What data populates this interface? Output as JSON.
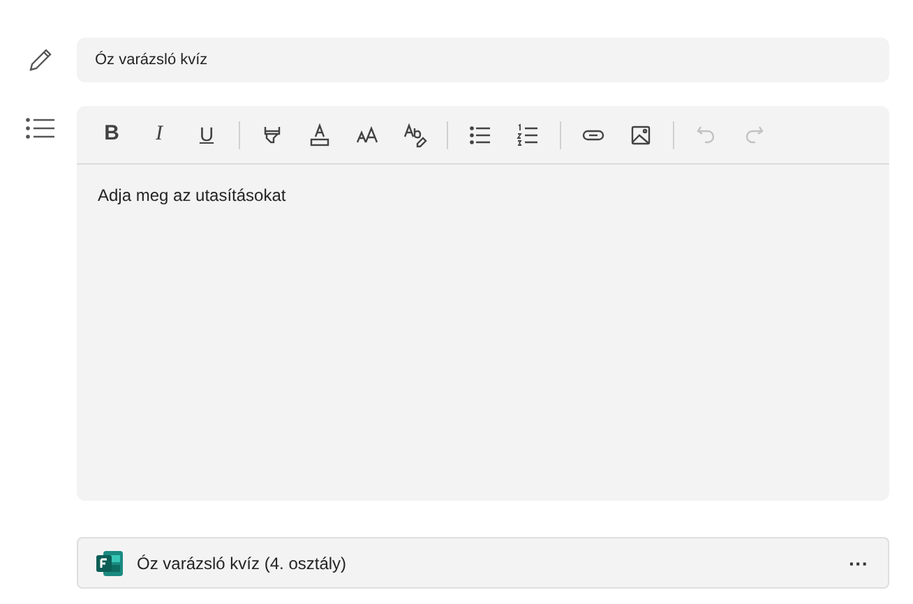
{
  "title_field": {
    "value": "Óz varázsló kvíz"
  },
  "toolbar": {
    "groups": [
      [
        {
          "kind": "bold",
          "glyph": "B",
          "disabled": false
        },
        {
          "kind": "italic",
          "glyph": "I",
          "disabled": false
        },
        {
          "kind": "underline",
          "glyph": "U",
          "disabled": false
        }
      ],
      [
        {
          "kind": "highlight",
          "disabled": false
        },
        {
          "kind": "font-color",
          "disabled": false
        },
        {
          "kind": "font-size",
          "disabled": false
        },
        {
          "kind": "clear-format",
          "disabled": false
        }
      ],
      [
        {
          "kind": "bullet-list",
          "disabled": false
        },
        {
          "kind": "numbered-list",
          "disabled": false
        }
      ],
      [
        {
          "kind": "link",
          "disabled": false
        },
        {
          "kind": "image",
          "disabled": false
        }
      ],
      [
        {
          "kind": "undo",
          "disabled": true
        },
        {
          "kind": "redo",
          "disabled": true
        }
      ]
    ]
  },
  "instructions": {
    "placeholder": "Adja meg az utasításokat"
  },
  "attachment": {
    "title": "Óz varázsló kvíz (4. osztály)",
    "menu": "···"
  }
}
